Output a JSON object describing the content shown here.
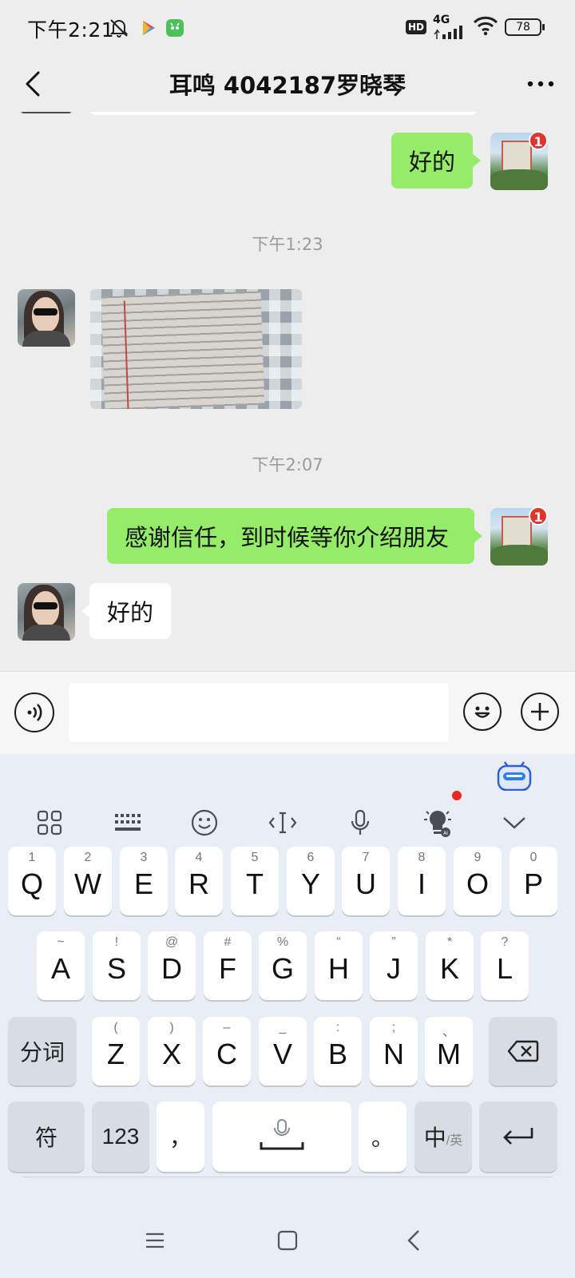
{
  "status_bar": {
    "time": "下午2:21",
    "hd": "HD",
    "network": "4G",
    "battery": "78"
  },
  "header": {
    "title": "耳鸣 4042187罗晓琴"
  },
  "messages": [
    {
      "type": "text",
      "direction": "sent",
      "text": "好的",
      "badge": "1"
    },
    {
      "type": "time",
      "text": "下午1:23"
    },
    {
      "type": "image",
      "direction": "received"
    },
    {
      "type": "time",
      "text": "下午2:07"
    },
    {
      "type": "text",
      "direction": "sent",
      "text": "感谢信任，到时候等你介绍朋友",
      "badge": "1"
    },
    {
      "type": "text",
      "direction": "received",
      "text": "好的"
    }
  ],
  "input_bar": {
    "value": "",
    "placeholder": ""
  },
  "keyboard": {
    "toolbar": [
      "apps-grid-icon",
      "keyboard-layout-icon",
      "emoji-icon",
      "cursor-icon",
      "microphone-icon",
      "lightbulb-ai-icon",
      "collapse-icon"
    ],
    "row1": [
      {
        "key": "Q",
        "sub": "1"
      },
      {
        "key": "W",
        "sub": "2"
      },
      {
        "key": "E",
        "sub": "3"
      },
      {
        "key": "R",
        "sub": "4"
      },
      {
        "key": "T",
        "sub": "5"
      },
      {
        "key": "Y",
        "sub": "6"
      },
      {
        "key": "U",
        "sub": "7"
      },
      {
        "key": "I",
        "sub": "8"
      },
      {
        "key": "O",
        "sub": "9"
      },
      {
        "key": "P",
        "sub": "0"
      }
    ],
    "row2": [
      {
        "key": "A",
        "sub": "~"
      },
      {
        "key": "S",
        "sub": "!"
      },
      {
        "key": "D",
        "sub": "@"
      },
      {
        "key": "F",
        "sub": "#"
      },
      {
        "key": "G",
        "sub": "%"
      },
      {
        "key": "H",
        "sub": "“"
      },
      {
        "key": "J",
        "sub": "”"
      },
      {
        "key": "K",
        "sub": "*"
      },
      {
        "key": "L",
        "sub": "?"
      }
    ],
    "row3": [
      {
        "key": "Z",
        "sub": "("
      },
      {
        "key": "X",
        "sub": ")"
      },
      {
        "key": "C",
        "sub": "–"
      },
      {
        "key": "V",
        "sub": "_"
      },
      {
        "key": "B",
        "sub": ":"
      },
      {
        "key": "N",
        "sub": ";"
      },
      {
        "key": "M",
        "sub": "、"
      }
    ],
    "segment_label": "分词",
    "symbols_label": "符",
    "numbers_label": "123",
    "comma_label": "，",
    "period_label": "。",
    "lang_main": "中",
    "lang_sub": "/英"
  },
  "colors": {
    "sent_bubble": "#95ec69",
    "received_bubble": "#ffffff",
    "chat_background": "#ededed",
    "badge": "#e0352e",
    "keyboard_background": "#e9edf5"
  }
}
